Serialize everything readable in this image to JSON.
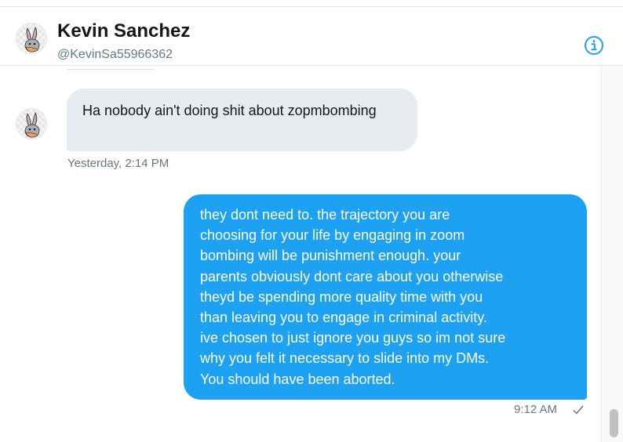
{
  "header": {
    "avatar_icon": "bunny-avatar-icon",
    "name": "Kevin Sanchez",
    "handle": "@KevinSa55966362",
    "info_icon": "info-circle-icon"
  },
  "messages": [
    {
      "direction": "incoming",
      "text": "Ha nobody ain't doing shit about zopmbombing",
      "timestamp": "Yesterday, 2:14 PM"
    },
    {
      "direction": "outgoing",
      "text": "they dont need to. the trajectory you are\nchoosing for your life by engaging in zoom\nbombing will be punishment enough. your\nparents obviously dont care about you otherwise\ntheyd be spending more quality time with you\nthan leaving you to engage in criminal activity.\nive chosen to just ignore you guys so im not sure\nwhy you felt it necessary to slide into my DMs.\nYou should have been aborted.",
      "timestamp": "9:12 AM",
      "status_icon": "checkmark-icon"
    }
  ],
  "colors": {
    "accent": "#1da1f2",
    "incoming_bubble": "#e6ecf0",
    "secondary_text": "#657786"
  }
}
